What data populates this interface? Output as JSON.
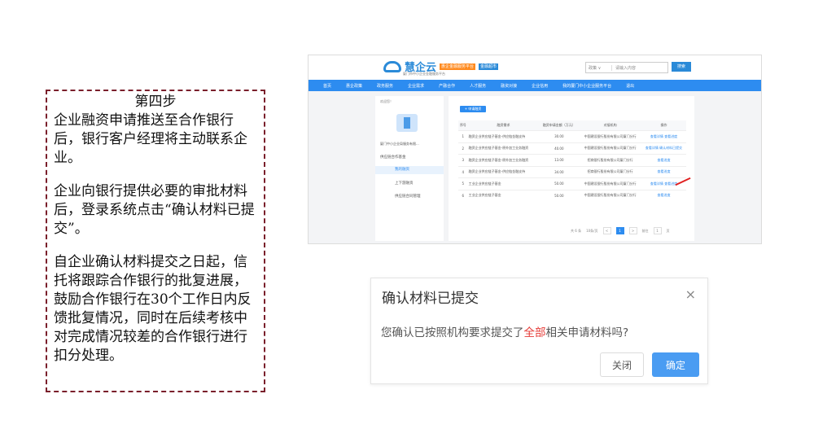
{
  "step_box": {
    "title": "第四步",
    "para1": "企业融资申请推送至合作银行后，银行客户经理将主动联系企业。",
    "para2": "企业向银行提供必要的审批材料后，登录系统点击“确认材料已提交”。",
    "para3": "自企业确认材料提交之日起，信托将跟踪合作银行的批复进展，鼓励合作银行在30个工作日内反馈批复情况，同时在后续考核中对完成情况较差的合作银行进行扣分处理。"
  },
  "app": {
    "logo_text": "慧企云",
    "logo_badge": "惠企金融服务平台",
    "logo_badge2": "金融超市",
    "logo_sub": "厦门市中小企业金融服务平台",
    "search_select": "政策 ∨",
    "search_placeholder": "请输入内容",
    "search_button": "搜索",
    "nav": [
      "首页",
      "惠企政策",
      "政务服务",
      "企业需求",
      "产融合作",
      "人才服务",
      "融资对接",
      "企业信用",
      "我的厦门中小企业服务平台",
      "退出"
    ],
    "left_title": "欢迎您！",
    "left_company": "厦门中小企业局服务有限...",
    "left_menu_group": "供应链合作基金",
    "left_menu": [
      "我的融资",
      "上下游融资",
      "供应链合同管理"
    ],
    "add_button": "+ 申请融资",
    "table_headers": [
      "序号",
      "融资需求",
      "融资申请金额（万元）",
      "对接机构",
      "操作"
    ],
    "rows": [
      {
        "no": "1",
        "name": "融资企业供应链子基金-供应链金融支持",
        "amount": "30.00",
        "bank": "中国建设银行股份有限公司厦门分行",
        "ops": "查看详情  查看进度"
      },
      {
        "no": "2",
        "name": "融资企业供应链子基金-原外加工业务融资",
        "amount": "40.00",
        "bank": "中国建设银行股份有限公司厦门分行",
        "ops": "查看详情  确认材料已提交"
      },
      {
        "no": "3",
        "name": "融资企业供应链子基金-原外加工业务融资",
        "amount": "13.00",
        "bank": "招商银行股份有限公司厦门分行",
        "ops": "查看进度"
      },
      {
        "no": "4",
        "name": "融资企业供应链子基金-供应链金融支持",
        "amount": "34.00",
        "bank": "招商银行股份有限公司厦门分行",
        "ops": "查看进度"
      },
      {
        "no": "5",
        "name": "工业企业供应链子基金",
        "amount": "50.00",
        "bank": "中国建设银行股份有限公司厦门分行",
        "ops": "查看详情  查看进度"
      },
      {
        "no": "6",
        "name": "工业企业供应链子基金",
        "amount": "50.00",
        "bank": "中国建设银行股份有限公司厦门分行",
        "ops": "查看进度"
      }
    ],
    "pager_total": "共 6 条",
    "pager_size": "10条/页",
    "pager_prev": "<",
    "pager_page": "1",
    "pager_next": ">",
    "pager_goto": "前往",
    "pager_goto_page": "1",
    "pager_page_unit": "页"
  },
  "dialog": {
    "title": "确认材料已提交",
    "close_icon": "×",
    "message_prefix": "您确认已按照机构要求提交了",
    "message_highlight": "全部",
    "message_suffix": "相关申请材料吗?",
    "cancel_label": "关闭",
    "ok_label": "确定",
    "highlight_color": "#e53935",
    "primary_color": "#4a9cf2"
  }
}
